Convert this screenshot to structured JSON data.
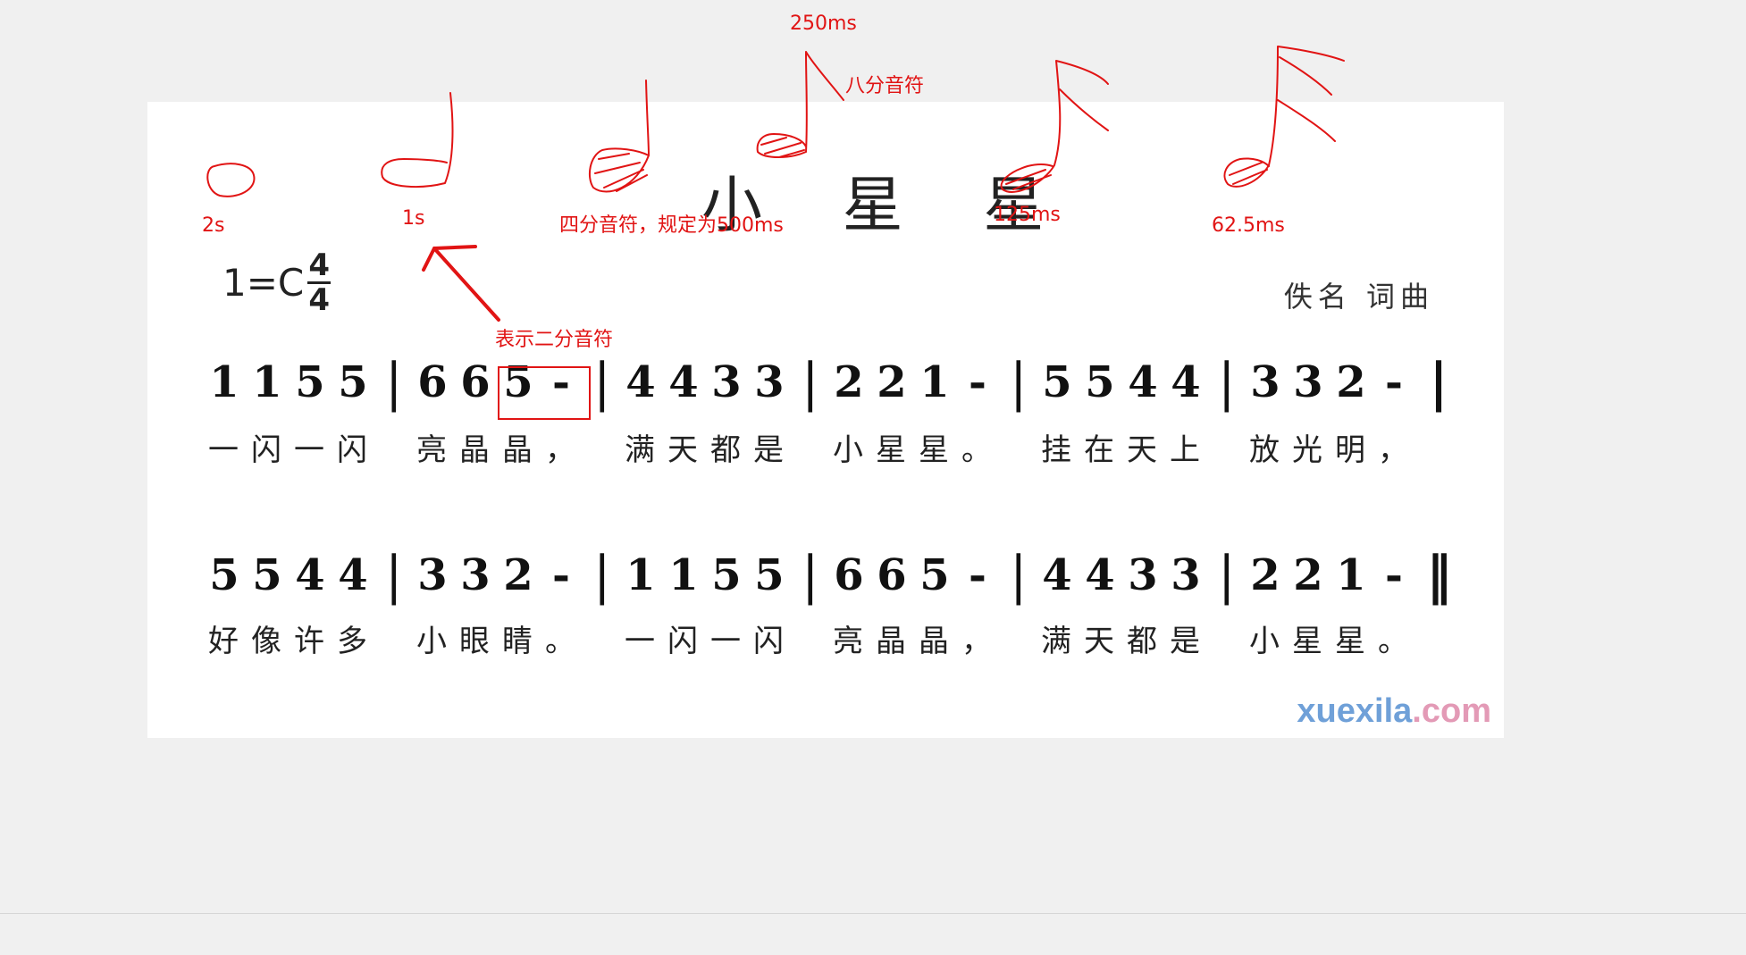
{
  "sheet": {
    "title": "小 星 星",
    "key": "1=C",
    "time_signature": {
      "top": "4",
      "bottom": "4"
    },
    "credit": "佚名 词曲",
    "watermark": {
      "main": "xuexila",
      "tld": ".com"
    }
  },
  "score": {
    "line1": {
      "measures": [
        [
          "1",
          "1",
          "5",
          "5"
        ],
        [
          "6",
          "6",
          "5",
          "-"
        ],
        [
          "4",
          "4",
          "3",
          "3"
        ],
        [
          "2",
          "2",
          "1",
          "-"
        ],
        [
          "5",
          "5",
          "4",
          "4"
        ],
        [
          "3",
          "3",
          "2",
          "-"
        ]
      ],
      "end_bar": "|",
      "lyrics": [
        "一闪一闪",
        "亮晶晶，",
        "满天都是",
        "小星星。",
        "挂在天上",
        "放光明，"
      ]
    },
    "line2": {
      "measures": [
        [
          "5",
          "5",
          "4",
          "4"
        ],
        [
          "3",
          "3",
          "2",
          "-"
        ],
        [
          "1",
          "1",
          "5",
          "5"
        ],
        [
          "6",
          "6",
          "5",
          "-"
        ],
        [
          "4",
          "4",
          "3",
          "3"
        ],
        [
          "2",
          "2",
          "1",
          "-"
        ]
      ],
      "end_bar": "‖",
      "lyrics": [
        "好像许多",
        "小眼睛。",
        "一闪一闪",
        "亮晶晶，",
        "满天都是",
        "小星星。"
      ]
    }
  },
  "annotations": {
    "whole_note": "2s",
    "half_note": "1s",
    "quarter_note": "四分音符，规定为500ms",
    "eighth_duration": "250ms",
    "eighth_name": "八分音符",
    "sixteenth": "125ms",
    "thirty_second": "62.5ms",
    "arrow_label": "表示二分音符"
  },
  "colors": {
    "annotation": "#e11414",
    "background": "#f0f0f0",
    "sheet": "#ffffff",
    "watermark_main": "#6fa0d8",
    "watermark_tld": "#e39ab6"
  }
}
